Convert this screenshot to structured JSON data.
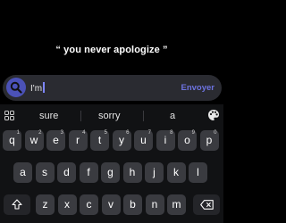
{
  "quote": "“ you never apologize ”",
  "input": {
    "value": "I'm",
    "send_label": "Envoyer"
  },
  "suggestions": [
    "sure",
    "sorry",
    "a"
  ],
  "keyboard": {
    "row1": [
      {
        "k": "q",
        "n": "1"
      },
      {
        "k": "w",
        "n": "2"
      },
      {
        "k": "e",
        "n": "3"
      },
      {
        "k": "r",
        "n": "4"
      },
      {
        "k": "t",
        "n": "5"
      },
      {
        "k": "y",
        "n": "6"
      },
      {
        "k": "u",
        "n": "7"
      },
      {
        "k": "i",
        "n": "8"
      },
      {
        "k": "o",
        "n": "9"
      },
      {
        "k": "p",
        "n": "0"
      }
    ],
    "row2": [
      "a",
      "s",
      "d",
      "f",
      "g",
      "h",
      "j",
      "k",
      "l"
    ],
    "row3": [
      "z",
      "x",
      "c",
      "v",
      "b",
      "n",
      "m"
    ]
  },
  "colors": {
    "accent": "#4b52b8",
    "send": "#6d73e0",
    "key": "#3a3b40",
    "key_dark": "#242529"
  }
}
